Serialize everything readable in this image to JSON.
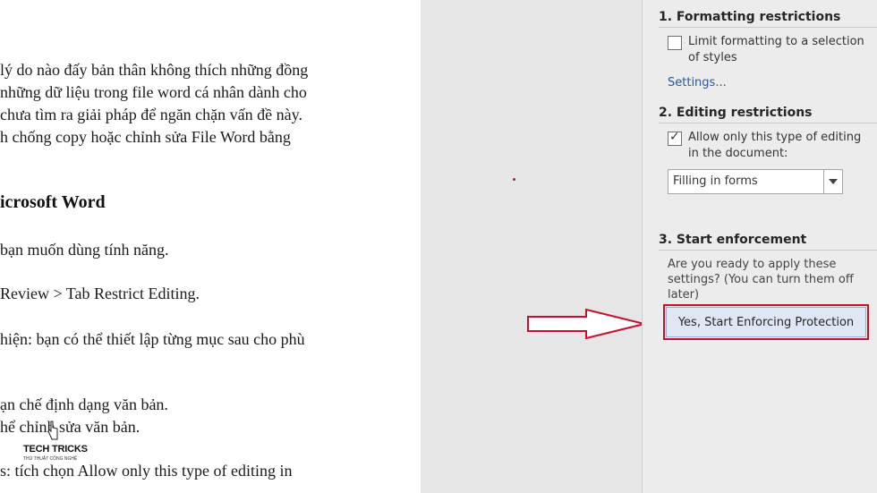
{
  "document": {
    "lines": [
      "lý do nào đấy bản thân không thích những đồng",
      " những dữ liệu trong file word cá nhân dành cho",
      "chưa tìm ra giải pháp để ngăn chặn vấn đề này.",
      "h chống copy hoặc chỉnh sửa File Word bằng",
      "icrosoft Word",
      "bạn muốn dùng tính năng.",
      "Review > Tab Restrict Editing.",
      "hiện: bạn có thể thiết lập từng mục sau cho phù",
      "ạn chế định dạng văn bản.",
      "hể chỉnh sửa văn bản.",
      "s: tích chọn Allow only this type of editing in"
    ]
  },
  "watermark": {
    "brand": "TECH TRICKS",
    "tagline": "THỦ THUẬT CÔNG NGHỆ"
  },
  "panel": {
    "formatting": {
      "title": "1. Formatting restrictions",
      "checkbox_label": "Limit formatting to a selection of styles",
      "checked": false,
      "settings_link": "Settings..."
    },
    "editing": {
      "title": "2. Editing restrictions",
      "checkbox_label": "Allow only this type of editing in the document:",
      "checked": true,
      "dropdown_value": "Filling in forms"
    },
    "enforcement": {
      "title": "3. Start enforcement",
      "prompt": "Are you ready to apply these settings? (You can turn them off later)",
      "button_label": "Yes, Start Enforcing Protection"
    }
  },
  "colors": {
    "highlight_red": "#c8102e",
    "link_blue": "#2b579a",
    "panel_bg": "#ececec"
  }
}
